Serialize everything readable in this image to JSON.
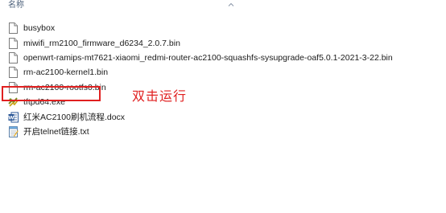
{
  "header": {
    "name_column": "名称",
    "sort_icon": "chevron-up-icon"
  },
  "files": [
    {
      "name": "busybox",
      "icon": "blank-file-icon"
    },
    {
      "name": "miwifi_rm2100_firmware_d6234_2.0.7.bin",
      "icon": "blank-file-icon"
    },
    {
      "name": "openwrt-ramips-mt7621-xiaomi_redmi-router-ac2100-squashfs-sysupgrade-oaf5.0.1-2021-3-22.bin",
      "icon": "blank-file-icon"
    },
    {
      "name": "rm-ac2100-kernel1.bin",
      "icon": "blank-file-icon"
    },
    {
      "name": "rm-ac2100-rootfs0.bin",
      "icon": "blank-file-icon"
    },
    {
      "name": "tftpd64.exe",
      "icon": "tftpd-exe-icon"
    },
    {
      "name": "红米AC2100刷机流程.docx",
      "icon": "word-docx-icon"
    },
    {
      "name": "开启telnet链接.txt",
      "icon": "notepad-txt-icon"
    }
  ],
  "annotation": {
    "text": "双击运行",
    "color": "#e02020"
  },
  "colors": {
    "highlight_border": "#e02020",
    "header_text": "#4c607a"
  }
}
